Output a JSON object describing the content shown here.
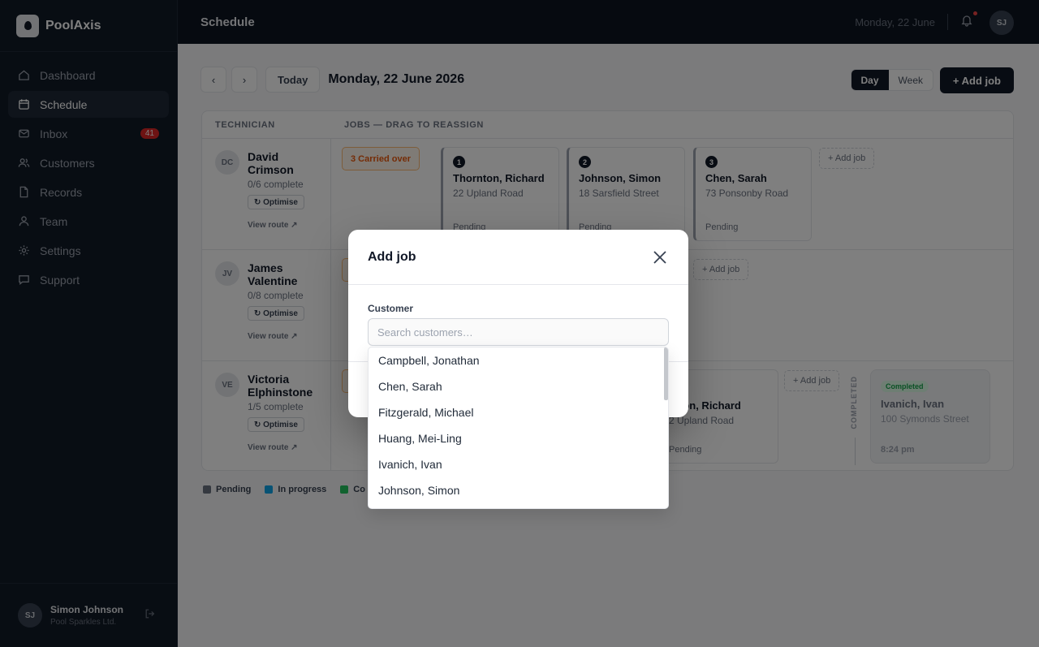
{
  "brand": {
    "name": "PoolAxis"
  },
  "sidebar": {
    "items": [
      {
        "label": "Dashboard",
        "icon": "home-icon"
      },
      {
        "label": "Schedule",
        "icon": "calendar-icon",
        "active": true
      },
      {
        "label": "Inbox",
        "icon": "mail-icon",
        "badge": "41"
      },
      {
        "label": "Customers",
        "icon": "users-icon"
      },
      {
        "label": "Records",
        "icon": "document-icon"
      },
      {
        "label": "Team",
        "icon": "user-icon"
      },
      {
        "label": "Settings",
        "icon": "gear-icon"
      },
      {
        "label": "Support",
        "icon": "chat-icon"
      }
    ],
    "user": {
      "initials": "SJ",
      "name": "Simon Johnson",
      "org": "Pool Sparkles Ltd."
    }
  },
  "topbar": {
    "title": "Schedule",
    "date": "Monday, 22 June",
    "avatar": "SJ"
  },
  "toolbar": {
    "prev": "‹",
    "next": "›",
    "today": "Today",
    "date_title": "Monday, 22 June 2026",
    "view_day": "Day",
    "view_week": "Week",
    "add_job": "+ Add job"
  },
  "grid": {
    "col_technician": "TECHNICIAN",
    "col_jobs": "JOBS — DRAG TO REASSIGN",
    "rows": [
      {
        "initials": "DC",
        "name": "David Crimson",
        "progress": "0/6 complete",
        "optimise": "↻ Optimise",
        "view_route": "View route ↗",
        "carried_over": "3  Carried over",
        "jobs": [
          {
            "num": "1",
            "name": "Thornton, Richard",
            "addr": "22 Upland Road",
            "status": "Pending"
          },
          {
            "num": "2",
            "name": "Johnson, Simon",
            "addr": "18 Sarsfield Street",
            "status": "Pending"
          },
          {
            "num": "3",
            "name": "Chen, Sarah",
            "addr": "73 Ponsonby Road",
            "status": "Pending"
          }
        ],
        "add_job": "+ Add job"
      },
      {
        "initials": "JV",
        "name": "James Valentine",
        "progress": "0/8 complete",
        "optimise": "↻ Optimise",
        "view_route": "View route ↗",
        "add_job": "+ Add job"
      },
      {
        "initials": "VE",
        "name": "Victoria Elphinstone",
        "progress": "1/5 complete",
        "optimise": "↻ Optimise",
        "view_route": "View route ↗",
        "jobs": [
          {
            "name": "rnton, Richard",
            "addr": "2 Upland Road",
            "status": "Pending"
          }
        ],
        "add_job": "+ Add job",
        "completed_label": "COMPLETED",
        "completed_job": {
          "badge": "Completed",
          "name": "Ivanich, Ivan",
          "addr": "100 Symonds Street",
          "time": "8:24 pm"
        }
      }
    ]
  },
  "legend": [
    {
      "label": "Pending",
      "color": "#6b7280"
    },
    {
      "label": "In progress",
      "color": "#0ea5e9"
    },
    {
      "label": "Co",
      "color": "#22c55e"
    }
  ],
  "modal": {
    "title": "Add job",
    "customer_label": "Customer",
    "search_placeholder": "Search customers…",
    "search_value": "",
    "options": [
      "Campbell, Jonathan",
      "Chen, Sarah",
      "Fitzgerald, Michael",
      "Huang, Mei-Ling",
      "Ivanich, Ivan",
      "Johnson, Simon"
    ]
  }
}
